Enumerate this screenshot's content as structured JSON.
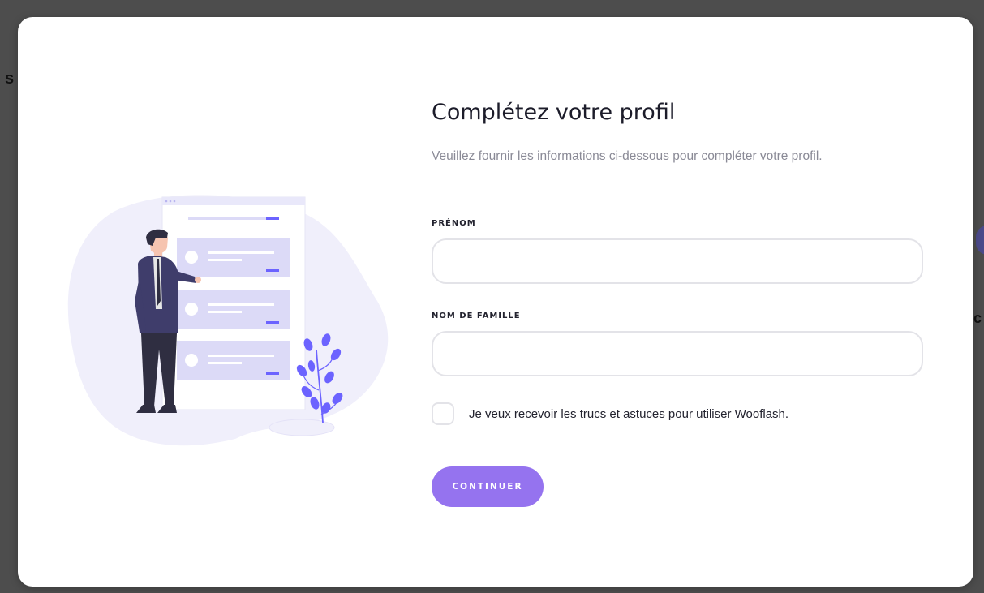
{
  "background": {
    "left_fragment": "s",
    "right_fragment": "c"
  },
  "modal": {
    "title": "Complétez votre profil",
    "subtitle": "Veuillez fournir les informations ci-dessous pour compléter votre profil.",
    "fields": {
      "first_name": {
        "label": "PRÉNOM",
        "value": "",
        "placeholder": ""
      },
      "last_name": {
        "label": "NOM DE FAMILLE",
        "value": "",
        "placeholder": ""
      }
    },
    "newsletter": {
      "label": "Je veux recevoir les trucs et astuces pour utiliser Wooflash.",
      "checked": false
    },
    "submit_label": "CONTINUER",
    "illustration": {
      "description_icon": "person-presenting-list-illustration",
      "accent_color": "#6c63ff",
      "blob_color": "#f0effb"
    }
  },
  "colors": {
    "primary": "#9573ef",
    "text": "#1c1c2a",
    "muted": "#8a8a96",
    "border": "#e3e3e8",
    "backdrop": "#4d4d4d"
  }
}
